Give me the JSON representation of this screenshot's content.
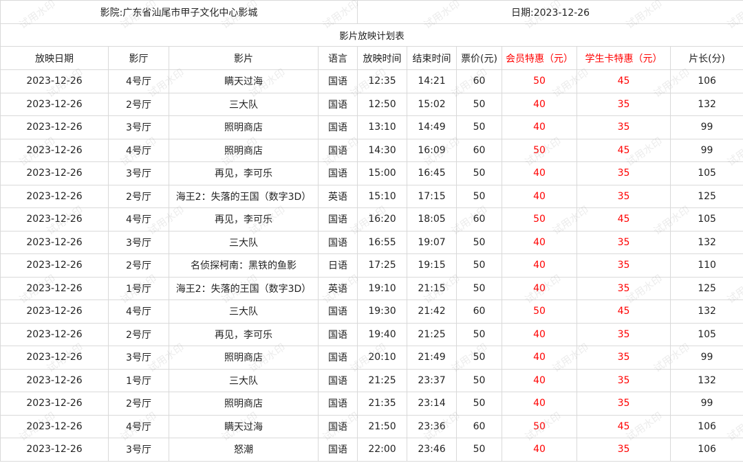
{
  "header": {
    "cinema": "影院:广东省汕尾市甲子文化中心影城",
    "date": "日期:2023-12-26",
    "title": "影片放映计划表"
  },
  "columns": [
    "放映日期",
    "影厅",
    "影片",
    "语言",
    "放映时间",
    "结束时间",
    "票价(元)",
    "会员特惠（元）",
    "学生卡特惠（元）",
    "片长(分)"
  ],
  "colors": {
    "accent_red": "#ff0000",
    "grid": "#d9d9d9"
  },
  "watermark": "试用水印",
  "rows": [
    [
      "2023-12-26",
      "4号厅",
      "瞒天过海",
      "国语",
      "12:35",
      "14:21",
      "60",
      "50",
      "45",
      "106"
    ],
    [
      "2023-12-26",
      "2号厅",
      "三大队",
      "国语",
      "12:50",
      "15:02",
      "50",
      "40",
      "35",
      "132"
    ],
    [
      "2023-12-26",
      "3号厅",
      "照明商店",
      "国语",
      "13:10",
      "14:49",
      "50",
      "40",
      "35",
      "99"
    ],
    [
      "2023-12-26",
      "4号厅",
      "照明商店",
      "国语",
      "14:30",
      "16:09",
      "60",
      "50",
      "45",
      "99"
    ],
    [
      "2023-12-26",
      "3号厅",
      "再见，李可乐",
      "国语",
      "15:00",
      "16:45",
      "50",
      "40",
      "35",
      "105"
    ],
    [
      "2023-12-26",
      "2号厅",
      "海王2：失落的王国（数字3D）",
      "英语",
      "15:10",
      "17:15",
      "50",
      "40",
      "35",
      "125"
    ],
    [
      "2023-12-26",
      "4号厅",
      "再见，李可乐",
      "国语",
      "16:20",
      "18:05",
      "60",
      "50",
      "45",
      "105"
    ],
    [
      "2023-12-26",
      "3号厅",
      "三大队",
      "国语",
      "16:55",
      "19:07",
      "50",
      "40",
      "35",
      "132"
    ],
    [
      "2023-12-26",
      "2号厅",
      "名侦探柯南：黑铁的鱼影",
      "日语",
      "17:25",
      "19:15",
      "50",
      "40",
      "35",
      "110"
    ],
    [
      "2023-12-26",
      "1号厅",
      "海王2：失落的王国（数字3D）",
      "英语",
      "19:10",
      "21:15",
      "50",
      "40",
      "35",
      "125"
    ],
    [
      "2023-12-26",
      "4号厅",
      "三大队",
      "国语",
      "19:30",
      "21:42",
      "60",
      "50",
      "45",
      "132"
    ],
    [
      "2023-12-26",
      "2号厅",
      "再见，李可乐",
      "国语",
      "19:40",
      "21:25",
      "50",
      "40",
      "35",
      "105"
    ],
    [
      "2023-12-26",
      "3号厅",
      "照明商店",
      "国语",
      "20:10",
      "21:49",
      "50",
      "40",
      "35",
      "99"
    ],
    [
      "2023-12-26",
      "1号厅",
      "三大队",
      "国语",
      "21:25",
      "23:37",
      "50",
      "40",
      "35",
      "132"
    ],
    [
      "2023-12-26",
      "2号厅",
      "照明商店",
      "国语",
      "21:35",
      "23:14",
      "50",
      "40",
      "35",
      "99"
    ],
    [
      "2023-12-26",
      "4号厅",
      "瞒天过海",
      "国语",
      "21:50",
      "23:36",
      "60",
      "50",
      "45",
      "106"
    ],
    [
      "2023-12-26",
      "3号厅",
      "怒潮",
      "国语",
      "22:00",
      "23:46",
      "50",
      "40",
      "35",
      "106"
    ]
  ]
}
